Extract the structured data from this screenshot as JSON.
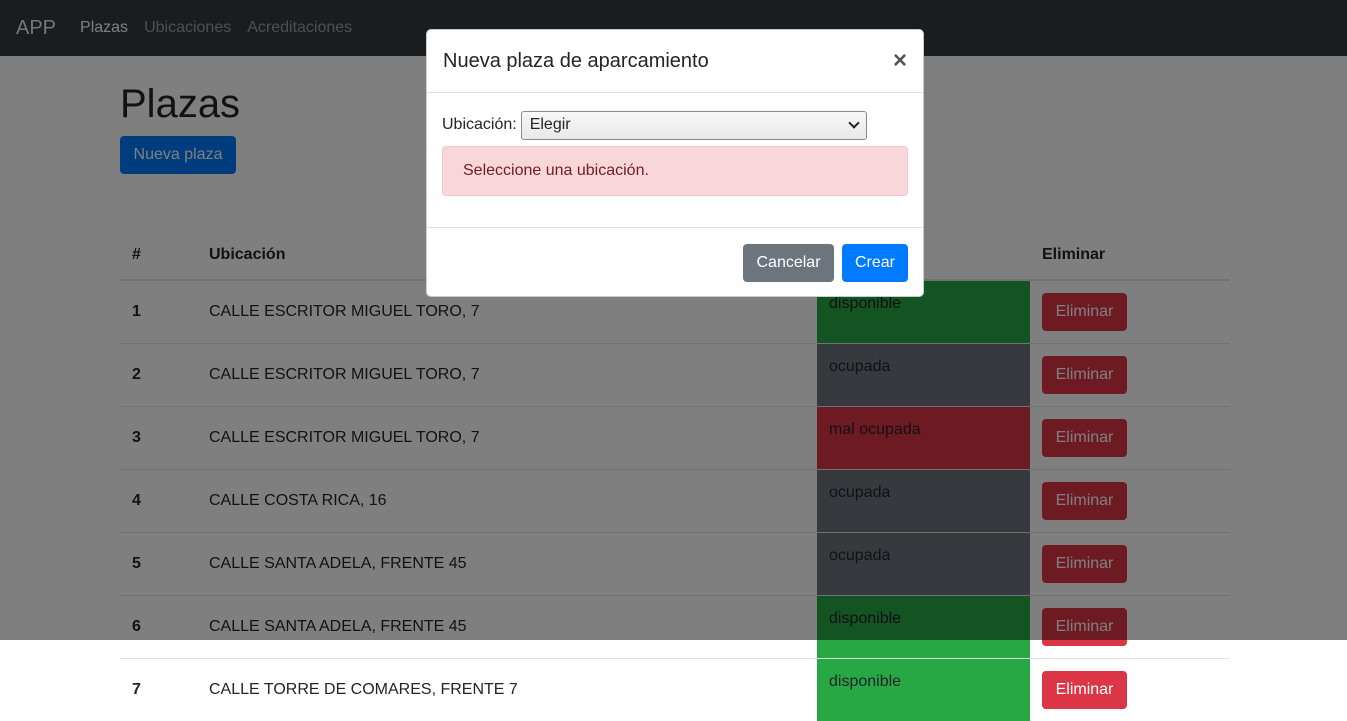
{
  "nav": {
    "brand": "APP",
    "links": [
      "Plazas",
      "Ubicaciones",
      "Acreditaciones"
    ]
  },
  "page": {
    "title": "Plazas",
    "new_button": "Nueva plaza"
  },
  "table": {
    "headers": [
      "#",
      "Ubicación",
      "",
      "Eliminar"
    ],
    "delete_label": "Eliminar",
    "rows": [
      {
        "num": "1",
        "ubicacion": "CALLE ESCRITOR MIGUEL TORO, 7",
        "estado": "disponible",
        "state_class": "st-disponible"
      },
      {
        "num": "2",
        "ubicacion": "CALLE ESCRITOR MIGUEL TORO, 7",
        "estado": "ocupada",
        "state_class": "st-ocupada"
      },
      {
        "num": "3",
        "ubicacion": "CALLE ESCRITOR MIGUEL TORO, 7",
        "estado": "mal ocupada",
        "state_class": "st-mal"
      },
      {
        "num": "4",
        "ubicacion": "CALLE COSTA RICA, 16",
        "estado": "ocupada",
        "state_class": "st-ocupada"
      },
      {
        "num": "5",
        "ubicacion": "CALLE SANTA ADELA, FRENTE 45",
        "estado": "ocupada",
        "state_class": "st-ocupada"
      },
      {
        "num": "6",
        "ubicacion": "CALLE SANTA ADELA, FRENTE 45",
        "estado": "disponible",
        "state_class": "st-disponible"
      },
      {
        "num": "7",
        "ubicacion": "CALLE TORRE DE COMARES, FRENTE 7",
        "estado": "disponible",
        "state_class": "st-disponible"
      }
    ]
  },
  "modal": {
    "title": "Nueva plaza de aparcamiento",
    "close_symbol": "×",
    "field_label": "Ubicación:",
    "select_value": "Elegir",
    "alert": "Seleccione una ubicación.",
    "cancel": "Cancelar",
    "create": "Crear"
  },
  "colors": {
    "primary": "#007bff",
    "danger": "#dc3545",
    "success": "#28a745",
    "secondary": "#6c757d",
    "navbar": "#343a40"
  }
}
